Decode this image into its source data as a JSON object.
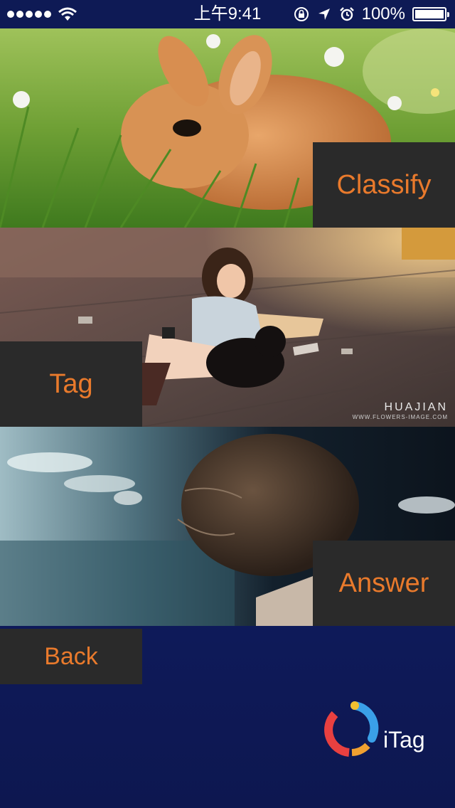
{
  "status_bar": {
    "time": "上午9:41",
    "battery_label": "100%",
    "battery_level": 1.0,
    "icons": [
      "signal-dots",
      "wifi-icon",
      "lock-rotation-icon",
      "location-icon",
      "alarm-icon",
      "battery-icon"
    ]
  },
  "panels": [
    {
      "button_label": "Classify",
      "image": "rabbit-in-grass"
    },
    {
      "button_label": "Tag",
      "image": "girl-with-dog",
      "watermark": "HUAJIAN",
      "watermark_sub": "WWW.FLOWERS-IMAGE.COM"
    },
    {
      "button_label": "Answer",
      "image": "person-hair-blowing"
    }
  ],
  "back_label": "Back",
  "logo": {
    "text": "iTag"
  },
  "colors": {
    "accent": "#e97a2c",
    "button_bg": "#2a2a2a",
    "background": "#16277a"
  }
}
